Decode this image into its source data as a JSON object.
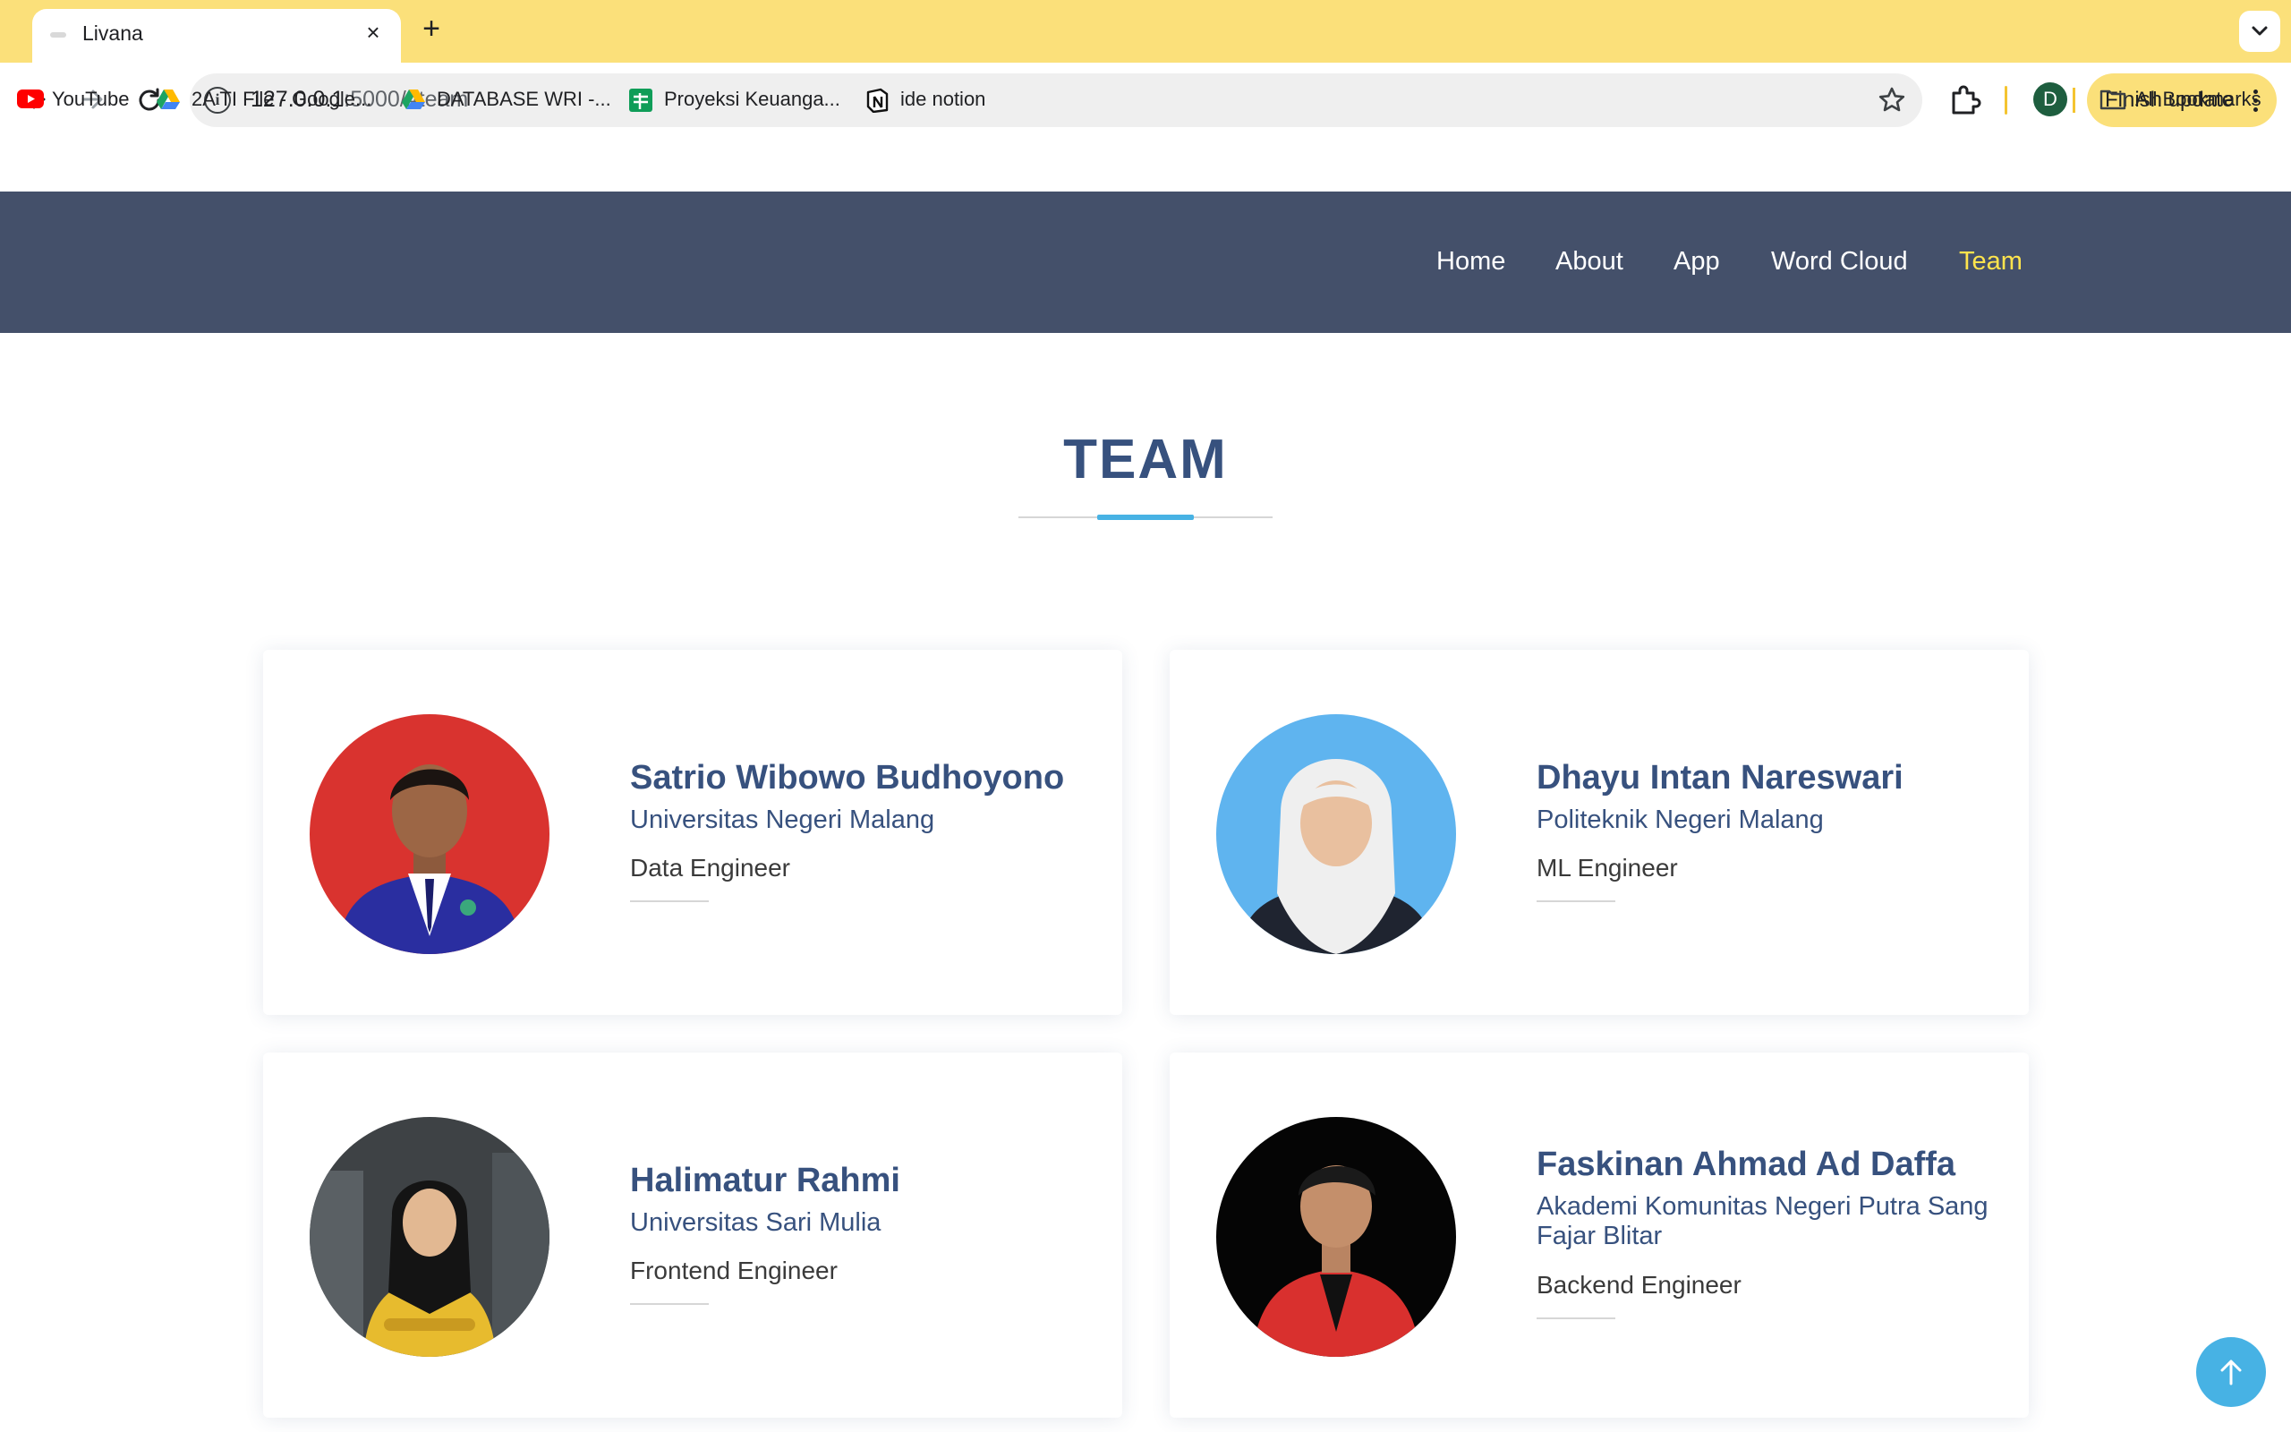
{
  "browser": {
    "tab_title": "Livana",
    "url_host": "127.0.0.1",
    "url_rest": ":5000/#team",
    "profile_initial": "D",
    "update_label": "Finish update",
    "bookmarks": [
      {
        "label": "YouTube",
        "icon": "youtube-icon"
      },
      {
        "label": "2A TI File - Google...",
        "icon": "google-drive-icon"
      },
      {
        "label": "DATABASE WRI -...",
        "icon": "google-drive-icon"
      },
      {
        "label": "Proyeksi Keuanga...",
        "icon": "google-sheets-icon"
      },
      {
        "label": "ide notion",
        "icon": "notion-icon"
      }
    ],
    "all_bookmarks_label": "All Bookmarks"
  },
  "nav": {
    "items": [
      {
        "label": "Home"
      },
      {
        "label": "About"
      },
      {
        "label": "App"
      },
      {
        "label": "Word Cloud"
      },
      {
        "label": "Team",
        "active": true
      }
    ]
  },
  "team": {
    "title": "TEAM",
    "members": [
      {
        "name": "Satrio Wibowo Budhoyono",
        "school": "Universitas Negeri Malang",
        "role": "Data Engineer",
        "photo_bg": "#d9332f",
        "outfit_color": "#2a2ea0"
      },
      {
        "name": "Dhayu Intan Nareswari",
        "school": "Politeknik Negeri Malang",
        "role": "ML Engineer",
        "photo_bg": "#5fb4ef",
        "outfit_color": "#1f2430"
      },
      {
        "name": "Halimatur Rahmi",
        "school": "Universitas Sari Mulia",
        "role": "Frontend Engineer",
        "photo_bg": "#3e4245",
        "outfit_color": "#e7bb2e"
      },
      {
        "name": "Faskinan Ahmad Ad Daffa",
        "school": "Akademi Komunitas Negeri Putra Sang Fajar Blitar",
        "role": "Backend Engineer",
        "photo_bg": "#050505",
        "outfit_color": "#d9302e"
      }
    ]
  },
  "colors": {
    "chrome_yellow": "#fbe07a",
    "nav_bg": "#44506a",
    "heading": "#37517e",
    "accent": "#47b2e4",
    "active_nav": "#ffe44d"
  }
}
